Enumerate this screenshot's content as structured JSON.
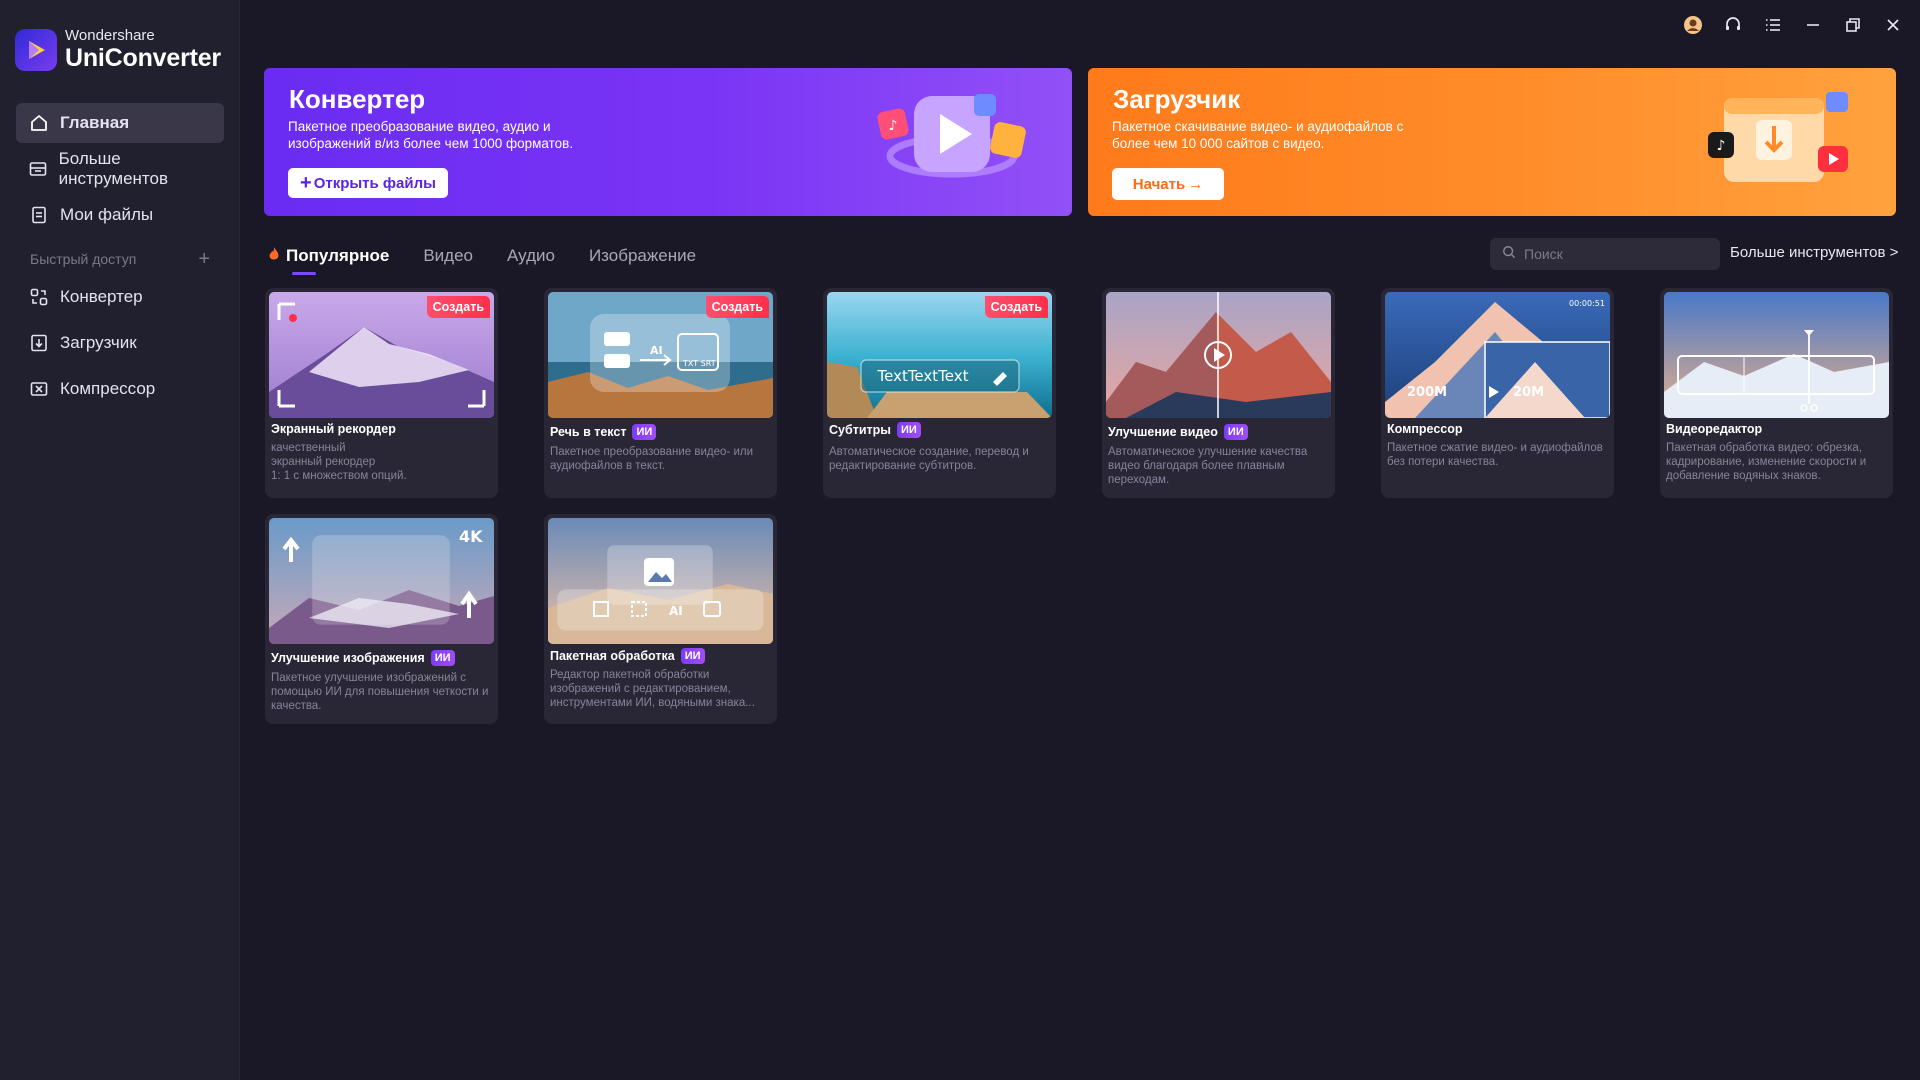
{
  "brand": {
    "sub": "Wondershare",
    "main": "UniConverter"
  },
  "sidebar": {
    "items": [
      {
        "label": "Главная",
        "icon": "home-icon"
      },
      {
        "label": "Больше инструментов",
        "icon": "toolbox-icon"
      },
      {
        "label": "Мои файлы",
        "icon": "file-icon"
      }
    ],
    "quick_access_label": "Быстрый доступ",
    "quick_items": [
      {
        "label": "Конвертер",
        "icon": "converter-icon"
      },
      {
        "label": "Загрузчик",
        "icon": "download-icon"
      },
      {
        "label": "Компрессор",
        "icon": "compress-icon"
      }
    ]
  },
  "banners": {
    "converter": {
      "title": "Конвертер",
      "desc": "Пакетное преобразование видео, аудио и изображений в/из более чем 1000 форматов.",
      "button": "Открыть файлы"
    },
    "downloader": {
      "title": "Загрузчик",
      "desc": "Пакетное скачивание видео- и аудиофайлов с более чем 10 000 сайтов с видео.",
      "button": "Начать"
    }
  },
  "tabs": [
    "Популярное",
    "Видео",
    "Аудио",
    "Изображение"
  ],
  "search": {
    "placeholder": "Поиск"
  },
  "more_tools": "Больше инструментов >",
  "create_badge": "Создать",
  "ai_badge": "ИИ",
  "cards": [
    {
      "title": "Экранный рекордер",
      "desc": "качественный\nэкранный рекордер\n1: 1 с множеством опций."
    },
    {
      "title": "Речь в текст",
      "desc": "Пакетное преобразование видео- или аудиофайлов в текст."
    },
    {
      "title": "Субтитры",
      "desc": "Автоматическое создание, перевод и редактирование субтитров.",
      "thumb_text": "TextTextText"
    },
    {
      "title": "Улучшение видео",
      "desc": "Автоматическое улучшение качества видео благодаря более плавным переходам."
    },
    {
      "title": "Компрессор",
      "desc": "Пакетное сжатие видео- и аудиофайлов без потери качества.",
      "thumb_from": "200M",
      "thumb_to": "20M",
      "thumb_time": "00:00:51"
    },
    {
      "title": "Видеоредактор",
      "desc": "Пакетная обработка видео: обрезка, кадрирование, изменение скорости и добавление водяных знаков."
    },
    {
      "title": "Улучшение изображения",
      "desc": "Пакетное улучшение изображений с помощью ИИ для повышения четкости и качества.",
      "thumb_text": "4K"
    },
    {
      "title": "Пакетная обработка",
      "desc": "Редактор пакетной обработки изображений с редактированием, инструментами ИИ, водяными знака..."
    }
  ],
  "colors": {
    "accent": "#7a4cf6",
    "converter_banner": "#6a2cf2",
    "downloader_banner": "#ff7a1a",
    "create_badge": "#ff3a57"
  }
}
